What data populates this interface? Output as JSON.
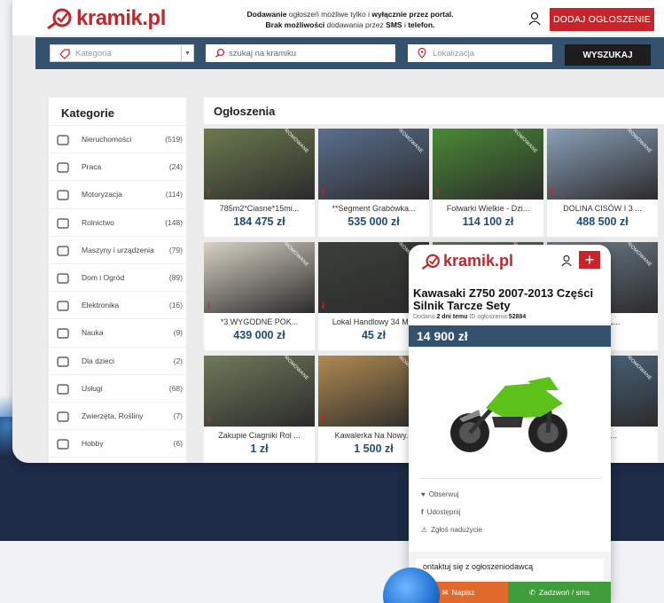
{
  "brand": {
    "name": "kramik.pl",
    "accent": "#c9242a",
    "nav": "#34526e",
    "price": "#1f4d7a"
  },
  "header": {
    "notice_line1_a": "Dodawanie",
    "notice_line1_b": " ogłoszeń możliwe tylko i ",
    "notice_line1_c": "wyłącznie przez portal.",
    "notice_line2_a": "Brak możliwości",
    "notice_line2_b": " dodawania przez ",
    "notice_line2_c": "SMS",
    "notice_line2_d": " i ",
    "notice_line2_e": "telefon.",
    "add_button": "DODAJ OGŁOSZENIE"
  },
  "search": {
    "category_placeholder": "Kategoria",
    "query_placeholder": "szukaj na kramiku",
    "location_placeholder": "Lokalizacja",
    "button": "WYSZUKAJ"
  },
  "sidebar": {
    "title": "Kategorie",
    "items": [
      {
        "label": "Nieruchomości",
        "count": "(519)",
        "icon": "house-icon"
      },
      {
        "label": "Praca",
        "count": "(24)",
        "icon": "briefcase-icon"
      },
      {
        "label": "Motoryzacja",
        "count": "(114)",
        "icon": "car-icon"
      },
      {
        "label": "Rolnictwo",
        "count": "(148)",
        "icon": "tractor-icon"
      },
      {
        "label": "Maszyny i urządzenia",
        "count": "(79)",
        "icon": "machine-icon"
      },
      {
        "label": "Dom i Ogród",
        "count": "(89)",
        "icon": "sofa-icon"
      },
      {
        "label": "Elektronika",
        "count": "(16)",
        "icon": "phone-icon"
      },
      {
        "label": "Nauka",
        "count": "(9)",
        "icon": "graduation-icon"
      },
      {
        "label": "Dla dzieci",
        "count": "(2)",
        "icon": "baby-icon"
      },
      {
        "label": "Usługi",
        "count": "(68)",
        "icon": "wrench-icon"
      },
      {
        "label": "Zwierzęta, Rośliny",
        "count": "(7)",
        "icon": "paw-icon"
      },
      {
        "label": "Hobby",
        "count": "(6)",
        "icon": "people-icon"
      }
    ]
  },
  "listings": {
    "title": "Ogłoszenia",
    "promo_label": "PROMOWANE",
    "cards": [
      {
        "title": "785m2*Ciasne*15mi...",
        "price": "184 475 zł",
        "color": "#6b7a4e"
      },
      {
        "title": "**Segment Grabówka...",
        "price": "535 000 zł",
        "color": "#5a6f8f"
      },
      {
        "title": "Folwarki Wielkie - Dzi...",
        "price": "114 100 zł",
        "color": "#4a8a35"
      },
      {
        "title": "DOLINA CISÓW I 3 ...",
        "price": "488 500 zł",
        "color": "#8aa0b8"
      },
      {
        "title": "*3 WYGODNE POK...",
        "price": "439 000 zł",
        "color": "#d9d2c4"
      },
      {
        "title": "Lokal Handlowy 34 M...",
        "price": "45 zł",
        "color": "#3b3f3a"
      },
      {
        "title": "",
        "price": "",
        "color": "#5d7a4a"
      },
      {
        "title": "ONA * L...",
        "price": "zł",
        "color": "#6e7f8f"
      },
      {
        "title": "Zakupie Ciagniki Rol ...",
        "price": "1 zł",
        "color": "#6f7a5a"
      },
      {
        "title": "Kawalerka Na Nowy...",
        "price": "1 500 zł",
        "color": "#b08a50"
      },
      {
        "title": "",
        "price": "",
        "color": "#8a9a70"
      },
      {
        "title": "Pracy ...",
        "price": "zł",
        "color": "#4f6f8a"
      }
    ]
  },
  "phone": {
    "title": "Kawasaki Z750 2007-2013 Części Silnik Tarcze Sety",
    "meta_a": "Dodano ",
    "meta_b": "2 dni temu",
    "meta_c": "  ID ogłoszenia:",
    "meta_d": "52884",
    "price": "14 900 zł",
    "follow": "Obserwuj",
    "share": "Udostępnij",
    "report": "Zgłoś nadużycie",
    "contact_title": "ontaktuj się z ogłoszeniodawcą",
    "write": "Napisz",
    "call": "Zadzwoń / sms"
  }
}
